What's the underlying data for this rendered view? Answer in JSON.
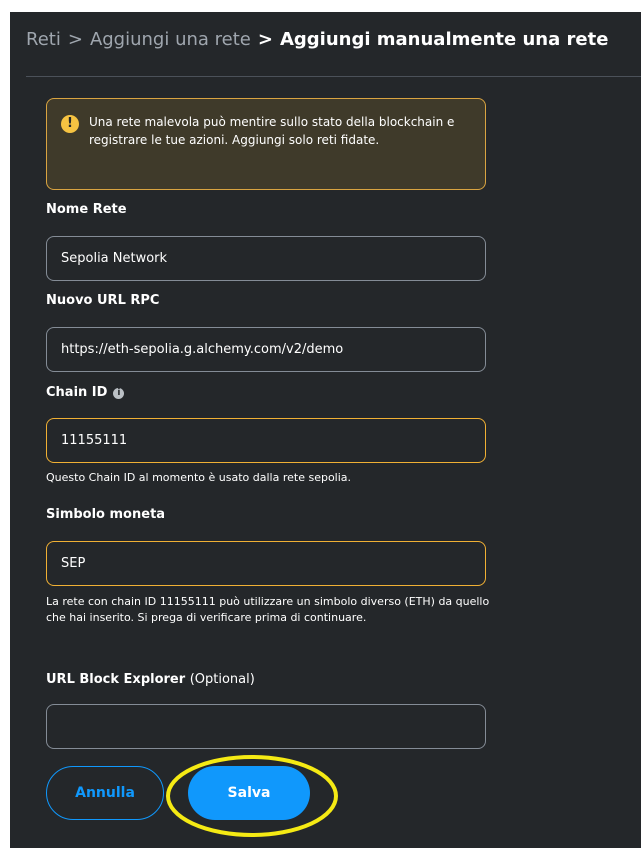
{
  "breadcrumb": {
    "networks": "Reti",
    "add_network": "Aggiungi una rete",
    "current": "Aggiungi manualmente una rete",
    "separator": ">"
  },
  "warning": {
    "icon": "!",
    "text": "Una rete malevola può mentire sullo stato della blockchain e registrare le tue azioni. Aggiungi solo reti fidate."
  },
  "fields": {
    "network_name": {
      "label": "Nome Rete",
      "value": "Sepolia Network"
    },
    "rpc_url": {
      "label": "Nuovo URL RPC",
      "value": "https://eth-sepolia.g.alchemy.com/v2/demo"
    },
    "chain_id": {
      "label": "Chain ID",
      "info_icon": "i",
      "value": "11155111",
      "helper": "Questo Chain ID al momento è usato dalla rete sepolia."
    },
    "currency_symbol": {
      "label": "Simbolo moneta",
      "value": "SEP",
      "helper": "La rete con chain ID 11155111 può utilizzare un simbolo diverso (ETH) da quello che hai inserito. Si prega di verificare prima di continuare."
    },
    "block_explorer": {
      "label": "URL Block Explorer",
      "optional": "(Optional)",
      "value": ""
    }
  },
  "buttons": {
    "cancel": "Annulla",
    "save": "Salva"
  },
  "colors": {
    "background": "#24272a",
    "primary": "#1098fc",
    "warning_border": "#f0b034",
    "highlight": "#f5ea14"
  },
  "icons": {
    "warning": "warning-icon",
    "info": "info-icon"
  }
}
